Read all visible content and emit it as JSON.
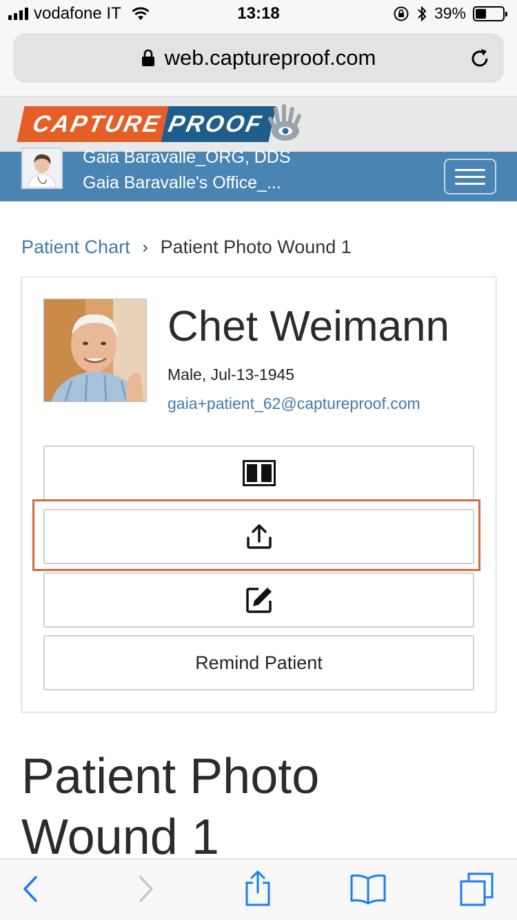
{
  "status_bar": {
    "carrier": "vodafone IT",
    "time": "13:18",
    "battery_percent": "39%",
    "battery_level": 0.39
  },
  "browser": {
    "url": "web.captureproof.com"
  },
  "brand": {
    "logo_part1": "CAPTURE",
    "logo_part2": "PROOF",
    "accent_orange": "#e35f27",
    "accent_blue": "#1e5d8c",
    "nav_color": "#4a84b3"
  },
  "doctor": {
    "name": "Gaia Baravalle_ORG, DDS",
    "office": "Gaia Baravalle's Office_..."
  },
  "breadcrumb": {
    "link": "Patient Chart",
    "separator": "›",
    "current": "Patient Photo Wound 1"
  },
  "patient": {
    "name": "Chet Weimann",
    "meta": "Male, Jul-13-1945",
    "email": "gaia+patient_62@captureproof.com"
  },
  "actions": {
    "compare_icon": "compare-columns-icon",
    "upload_icon": "upload-icon",
    "edit_icon": "edit-icon",
    "remind_label": "Remind Patient"
  },
  "page": {
    "heading": "Patient Photo Wound 1"
  },
  "toolbar": {
    "icons": [
      "back-icon",
      "forward-icon",
      "share-icon",
      "bookmarks-icon",
      "tabs-icon"
    ]
  }
}
